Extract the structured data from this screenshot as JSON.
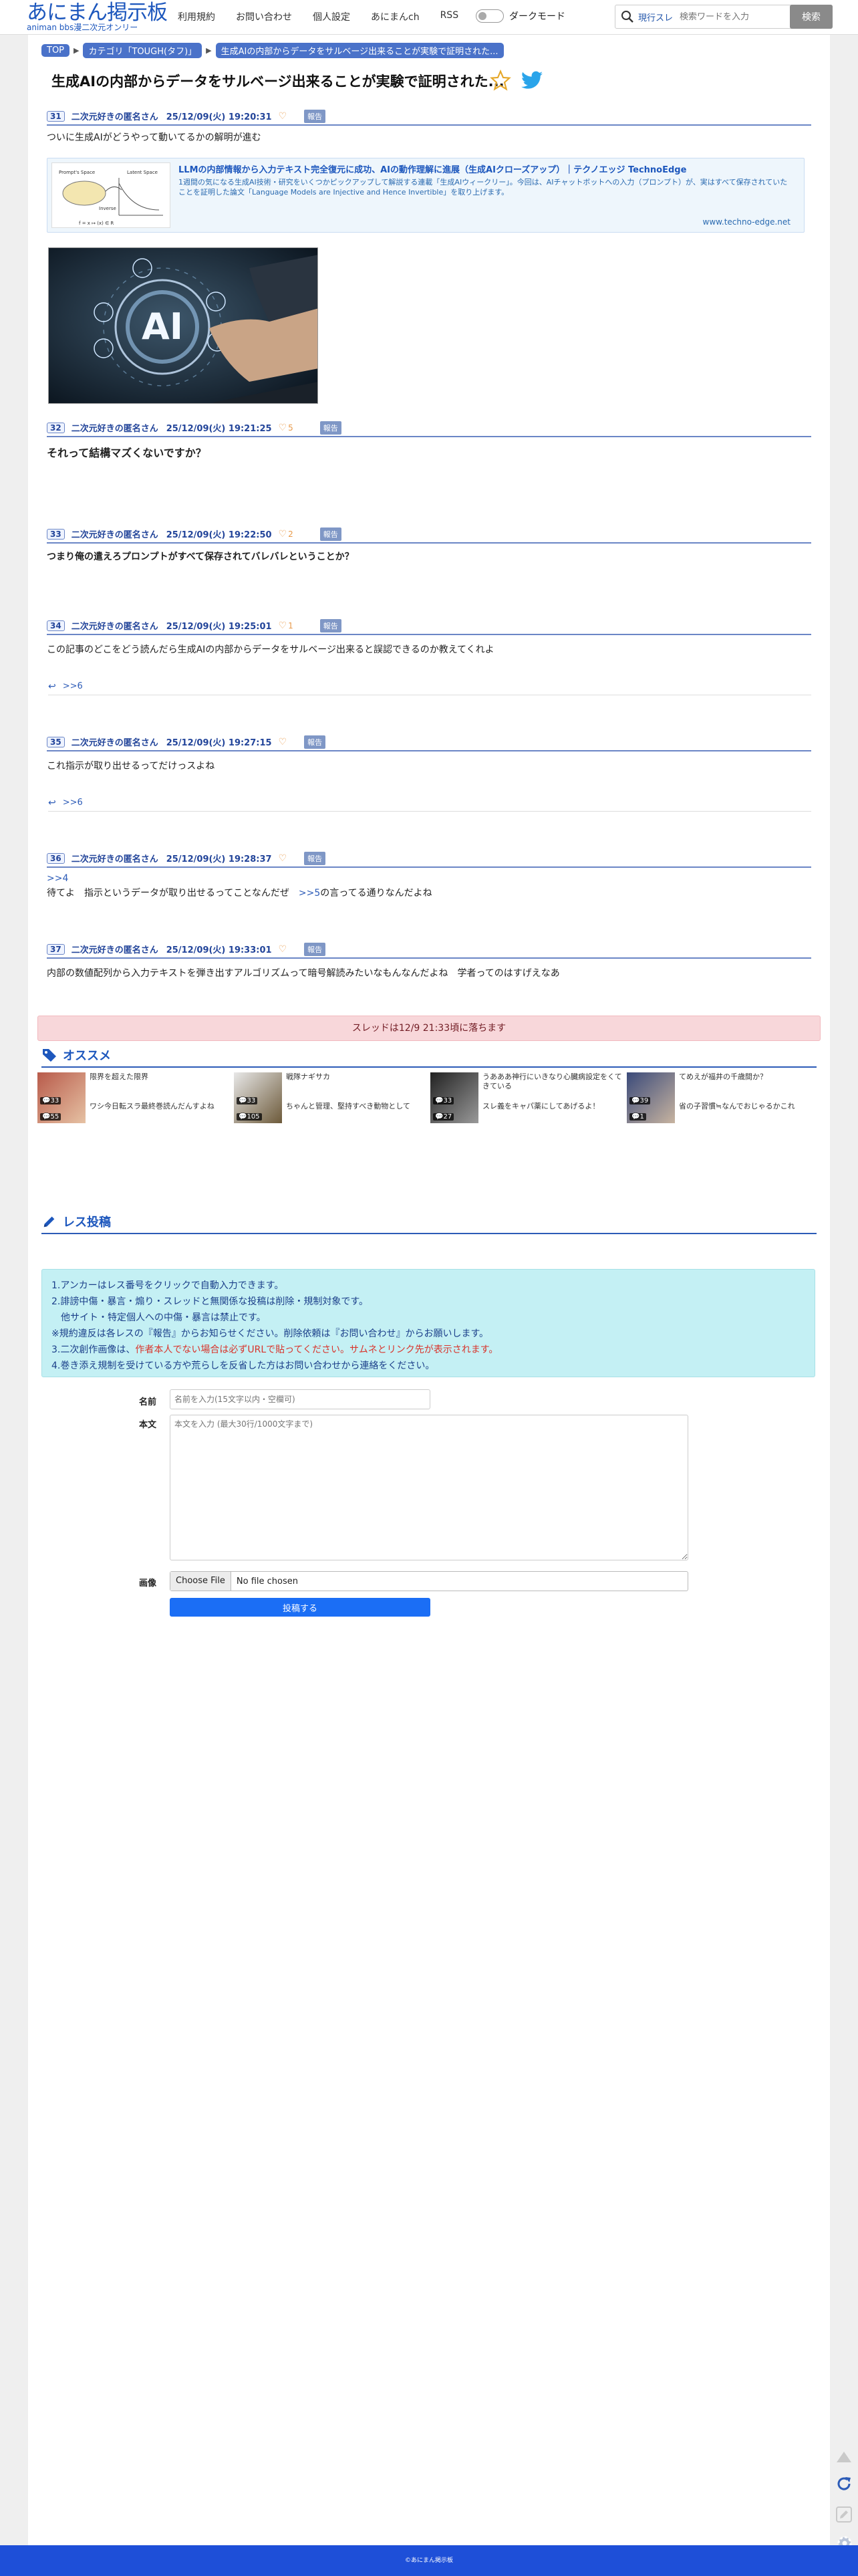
{
  "header": {
    "logo_main": "あにまん掲示板",
    "logo_sub": "animan bbs漫二次元オンリー",
    "nav": [
      "利用規約",
      "お問い合わせ",
      "個人設定",
      "あにまんch",
      "RSS"
    ],
    "dark_mode_label": "ダークモード",
    "search_current_label": "現行スレ",
    "search_placeholder": "検索ワードを入力",
    "search_button": "検索"
  },
  "breadcrumb": [
    "TOP",
    "カテゴリ「TOUGH(タフ)」",
    "生成AIの内部からデータをサルベージ出来ることが実験で証明された..."
  ],
  "thread_title": "生成AIの内部からデータをサルベージ出来ることが実験で証明された...",
  "report_label": "報告",
  "posts": [
    {
      "num": "31",
      "name": "二次元好きの匿名さん",
      "date": "25/12/09(火) 19:20:31",
      "likes": "",
      "body": "ついに生成AIがどうやって動いてるかの解明が進む"
    },
    {
      "num": "32",
      "name": "二次元好きの匿名さん",
      "date": "25/12/09(火) 19:21:25",
      "likes": "5",
      "body": "それって結構マズくないですか？"
    },
    {
      "num": "33",
      "name": "二次元好きの匿名さん",
      "date": "25/12/09(火) 19:22:50",
      "likes": "2",
      "body": "つまり俺の遣えろプロンプトがすべて保存されてバレバレということか？"
    },
    {
      "num": "34",
      "name": "二次元好きの匿名さん",
      "date": "25/12/09(火) 19:25:01",
      "likes": "1",
      "body": "この記事のどこをどう読んだら生成AIの内部からデータをサルベージ出来ると誤認できるのか教えてくれよ",
      "reply": ">>6"
    },
    {
      "num": "35",
      "name": "二次元好きの匿名さん",
      "date": "25/12/09(火) 19:27:15",
      "likes": "",
      "body": "これ指示が取り出せるってだけっスよね",
      "reply": ">>6"
    },
    {
      "num": "36",
      "name": "二次元好きの匿名さん",
      "date": "25/12/09(火) 19:28:37",
      "likes": "",
      "anchor": ">>4",
      "body": "待てよ　指示というデータが取り出せるってことなんだぜ　",
      "anchor2": ">>5",
      "body2": "の言ってる通りなんだよね"
    },
    {
      "num": "37",
      "name": "二次元好きの匿名さん",
      "date": "25/12/09(火) 19:33:01",
      "likes": "",
      "body": "内部の数値配列から入力テキストを弾き出すアルゴリズムって暗号解読みたいなもんなんだよね　学者ってのはすげえなあ"
    }
  ],
  "link_card": {
    "title": "LLMの内部情報から入力テキスト完全復元に成功、AIの動作理解に進展（生成AIクローズアップ）｜テクノエッジ TechnoEdge",
    "desc": "1週間の気になる生成AI技術・研究をいくつかピックアップして解説する連載「生成AIウィークリー」。今回は、AIチャットボットへの入力（プロンプト）が、実はすべて保存されていたことを証明した論文「Language Models are Injective and Hence Invertible」を取り上げます。",
    "url": "www.techno-edge.net",
    "thumb_labels": [
      "Prompt's Space",
      "Latent Space",
      "Inverse",
      "f = x ↦ (x) ∈ R"
    ]
  },
  "ai_image_text": "AI",
  "thread_end": "スレッドは12/9 21:33頃に落ちます",
  "recommend": {
    "heading": "オススメ",
    "items": [
      {
        "t1": "限界を超えた限界",
        "count1": "33",
        "t2": "ワシ今日転スラ最終巻読んだんすよね",
        "count2": "55"
      },
      {
        "t1": "戦隊ナギサカ",
        "count1": "33",
        "t2": "ちゃんと管理、堅持すべき動物として",
        "count2": "105"
      },
      {
        "t1": "うあああ神行にいきなり心臓病設定をくてきている",
        "count1": "33",
        "t2": "スレ義をキャパ薬にしてあげるよ！",
        "count2": "27"
      },
      {
        "t1": "てめえが福井の千歳間か？",
        "count1": "39",
        "t2": "省の子習慣≒なんでおじゃるかこれ",
        "count2": "1"
      }
    ]
  },
  "reply_form": {
    "heading": "レス投稿",
    "rules": [
      "1.アンカーはレス番号をクリックで自動入力できます。",
      "2.誹謗中傷・暴言・煽り・スレッドと無関係な投稿は削除・規制対象です。",
      "　他サイト・特定個人への中傷・暴言は禁止です。",
      "※規約違反は各レスの『報告』からお知らせください。削除依頼は『お問い合わせ』からお願いします。",
      "3.二次創作画像は、",
      "作者本人でない場合は必ずURLで貼ってください。サムネとリンク先が表示されます。",
      "4.巻き添え規制を受けている方や荒らしを反省した方はお問い合わせから連絡をください。"
    ],
    "name_label": "名前",
    "name_placeholder": "名前を入力(15文字以内・空欄可)",
    "body_label": "本文",
    "body_placeholder": "本文を入力 (最大30行/1000文字まで)",
    "image_label": "画像",
    "file_button": "Choose File",
    "file_status": "No file chosen",
    "submit": "投稿する"
  },
  "footer": "©あにまん掲示板",
  "colors": {
    "accent": "#1d57bd",
    "bar_bg": "#f8d7da",
    "rules_bg": "#c4f0f4",
    "footer": "#1e4fd8"
  }
}
